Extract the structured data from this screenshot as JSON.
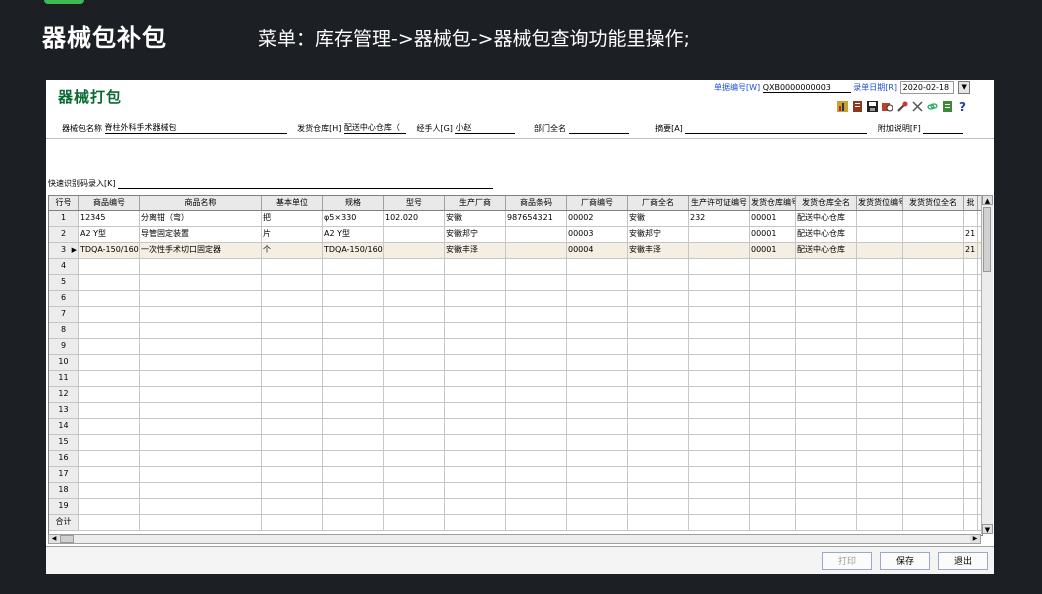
{
  "slide": {
    "title": "器械包补包",
    "caption": "菜单：库存管理->器械包->器械包查询功能里操作;"
  },
  "window": {
    "title": "器械打包",
    "doc_no_label": "单据编号[W]",
    "doc_no_value": "QXB0000000003",
    "date_label": "录单日期[R]",
    "date_value": "2020-02-18",
    "form": {
      "pkg_name_label": "器械包名称",
      "pkg_name_value": "脊柱外科手术器械包",
      "warehouse_label": "发货仓库[H]",
      "warehouse_value": "配送中心仓库（",
      "handler_label": "经手人[G]",
      "handler_value": "小赵",
      "dept_label": "部门全名",
      "dept_value": "",
      "summary_label": "摘要[A]",
      "summary_value": "",
      "note_label": "附加说明[F]",
      "note_value": ""
    },
    "quick_entry_label": "快速识别码录入[K]",
    "toolbar_icons": [
      "chart-icon",
      "report-icon",
      "save-icon",
      "print-preview-icon",
      "tools-icon",
      "scissors-icon",
      "link-icon",
      "doc-icon",
      "help-icon"
    ],
    "table": {
      "headers": [
        "行号",
        "商品编号",
        "商品名称",
        "基本单位",
        "规格",
        "型号",
        "生产厂商",
        "商品条码",
        "厂商编号",
        "厂商全名",
        "生产许可证编号",
        "发货仓库编号",
        "发货仓库全名",
        "发货货位编号",
        "发货货位全名",
        "批"
      ],
      "rows": [
        [
          "1",
          "12345",
          "分离钳（弯）",
          "把",
          "φ5×330",
          "102.020",
          "安徽",
          "987654321",
          "00002",
          "安徽",
          "232",
          "00001",
          "配送中心仓库",
          "",
          "",
          ""
        ],
        [
          "2",
          "A2 Y型",
          "导管固定装置",
          "片",
          "A2 Y型",
          "",
          "安徽邦宁",
          "",
          "00003",
          "安徽邦宁",
          "",
          "00001",
          "配送中心仓库",
          "",
          "",
          "21"
        ],
        [
          "3",
          "TDQA-150/160-",
          "一次性手术切口固定器",
          "个",
          "TDQA-150/160-",
          "",
          "安徽丰泽",
          "",
          "00004",
          "安徽丰泽",
          "",
          "00001",
          "配送中心仓库",
          "",
          "",
          "21"
        ]
      ],
      "row_numbers": [
        "4",
        "5",
        "6",
        "7",
        "8",
        "9",
        "10",
        "11",
        "12",
        "13",
        "14",
        "15",
        "16",
        "17",
        "18",
        "19"
      ],
      "total_label": "合计",
      "selected_row": 3
    },
    "buttons": {
      "print": "打印",
      "save": "保存",
      "exit": "退出"
    }
  },
  "colors": {
    "background": "#1c1f24",
    "accent": "#3fb950",
    "window_title": "#0b6a33",
    "label_blue": "#1f4fd1"
  }
}
